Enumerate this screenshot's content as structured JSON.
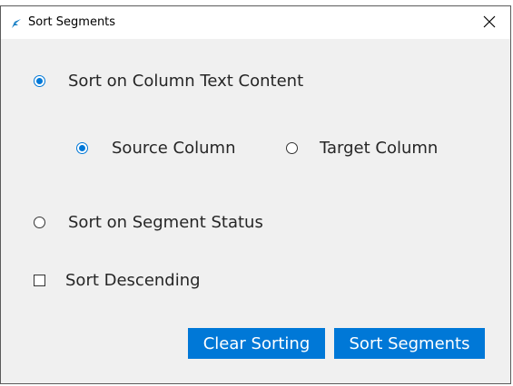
{
  "window": {
    "title": "Sort Segments"
  },
  "options": {
    "sort_text_label": "Sort on Column Text Content",
    "source_column_label": "Source Column",
    "target_column_label": "Target Column",
    "sort_status_label": "Sort on Segment Status",
    "sort_descending_label": "Sort Descending"
  },
  "buttons": {
    "clear_sorting": "Clear Sorting",
    "sort_segments": "Sort Segments"
  },
  "colors": {
    "accent": "#0078d7",
    "window_bg": "#f0f0f0",
    "titlebar_bg": "#ffffff"
  },
  "icons": {
    "app": "app-logo-icon",
    "close": "close-icon"
  }
}
